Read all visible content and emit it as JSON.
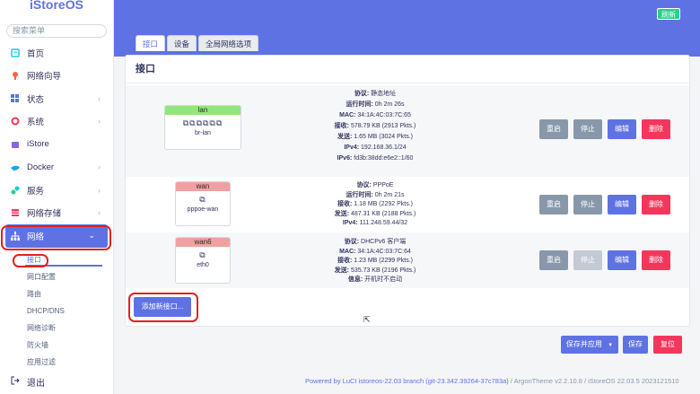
{
  "app": {
    "logo": "iStoreOS"
  },
  "sidebar": {
    "search_placeholder": "搜索菜单",
    "items": [
      {
        "label": "首页",
        "icon": "home-icon"
      },
      {
        "label": "网络向导",
        "icon": "wizard-icon"
      },
      {
        "label": "状态",
        "icon": "status-icon"
      },
      {
        "label": "系统",
        "icon": "system-icon"
      },
      {
        "label": "iStore",
        "icon": "store-icon"
      },
      {
        "label": "Docker",
        "icon": "docker-icon"
      },
      {
        "label": "服务",
        "icon": "services-icon"
      },
      {
        "label": "网络存储",
        "icon": "storage-icon"
      },
      {
        "label": "网络",
        "icon": "network-icon"
      }
    ],
    "subitems": [
      "接口",
      "网口配置",
      "路由",
      "DHCP/DNS",
      "网络诊断",
      "防火墙",
      "应用过滤"
    ],
    "exit_label": "退出"
  },
  "header": {
    "refresh_label": "刷新"
  },
  "tabs": [
    "接口",
    "设备",
    "全局网络选项"
  ],
  "panel": {
    "title": "接口"
  },
  "interfaces": [
    {
      "name": "lan",
      "device": "br-lan",
      "header_color": "#90e87a",
      "info": [
        {
          "k": "协议:",
          "v": "静态地址"
        },
        {
          "k": "运行时间:",
          "v": "0h 2m 26s"
        },
        {
          "k": "MAC:",
          "v": "34:1A:4C:03:7C:65"
        },
        {
          "k": "接收:",
          "v": "578.79 KB (2913 Pkts.)"
        },
        {
          "k": "发送:",
          "v": "1.65 MB (3024 Pkts.)"
        },
        {
          "k": "IPv4:",
          "v": "192.168.36.1/24"
        },
        {
          "k": "IPv6:",
          "v": "fd3b:38dd:e6e2::1/60"
        }
      ]
    },
    {
      "name": "wan",
      "device": "pppoe-wan",
      "header_color": "#f0a0a0",
      "info": [
        {
          "k": "协议:",
          "v": "PPPoE"
        },
        {
          "k": "运行时间:",
          "v": "0h 2m 21s"
        },
        {
          "k": "接收:",
          "v": "1.18 MB (2292 Pkts.)"
        },
        {
          "k": "发送:",
          "v": "487.31 KB (2188 Pkts.)"
        },
        {
          "k": "IPv4:",
          "v": "111.248.59.44/32"
        }
      ]
    },
    {
      "name": "wan6",
      "device": "eth0",
      "header_color": "#f0a0a0",
      "info": [
        {
          "k": "协议:",
          "v": "DHCPv6 客户端"
        },
        {
          "k": "MAC:",
          "v": "34:1A:4C:03:7C:64"
        },
        {
          "k": "接收:",
          "v": "1.23 MB (2299 Pkts.)"
        },
        {
          "k": "发送:",
          "v": "535.73 KB (2196 Pkts.)"
        },
        {
          "k": "信息:",
          "v": "开机时不启动"
        }
      ]
    }
  ],
  "row_buttons": {
    "restart": "重启",
    "stop": "停止",
    "edit": "编辑",
    "delete": "删除"
  },
  "add_button": "添加新接口...",
  "bottom": {
    "save_apply": "保存并应用",
    "save": "保存",
    "reset": "复位"
  },
  "footer": {
    "luci": "Powered by LuCI istoreos-22.03 branch (git-23.342.39264-37c783a)",
    "theme": " / ArgonTheme v2.2.10.8 / ",
    "os": "iStoreOS 22.03.5 2023121510"
  },
  "colors": {
    "accent": "#5e72e4",
    "danger": "#f5365c",
    "success": "#2dce89",
    "highlight": "#e32020"
  }
}
